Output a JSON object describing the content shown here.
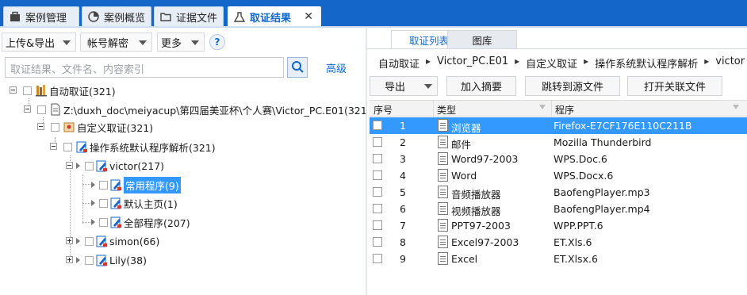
{
  "tabs": [
    {
      "label": "案例管理",
      "icon": "briefcase-icon"
    },
    {
      "label": "案例概览",
      "icon": "pie-chart-icon"
    },
    {
      "label": "证据文件",
      "icon": "folder-icon"
    },
    {
      "label": "取证结果",
      "icon": "flask-icon",
      "active": true
    }
  ],
  "toolbar": {
    "upload_export": "上传&导出",
    "account_decrypt": "帐号解密",
    "more": "更多",
    "help": "?"
  },
  "search": {
    "placeholder": "取证结果、文件名、内容索引",
    "advanced": "高级"
  },
  "tree": [
    {
      "label": "自动取证(321)"
    },
    {
      "label": "Z:\\duxh_doc\\meiyacup\\第四届美亚杯\\个人赛\\Victor_PC.E01(321)"
    },
    {
      "label": "自定义取证(321)"
    },
    {
      "label": "操作系统默认程序解析(321)"
    },
    {
      "label": "victor(217)"
    },
    {
      "label": "常用程序(9)",
      "selected": true
    },
    {
      "label": "默认主页(1)"
    },
    {
      "label": "全部程序(207)"
    },
    {
      "label": "simon(66)"
    },
    {
      "label": "Lily(38)"
    }
  ],
  "right": {
    "subtabs": [
      "取证列表",
      "图库"
    ],
    "breadcrumb": [
      "自动取证",
      "Victor_PC.E01",
      "自定义取证",
      "操作系统默认程序解析",
      "victor"
    ],
    "buttons": {
      "export": "导出",
      "add_summary": "加入摘要",
      "jump_source": "跳转到源文件",
      "open_related": "打开关联文件"
    },
    "columns": [
      "序号",
      "类型",
      "程序"
    ],
    "rows": [
      {
        "num": "1",
        "type": "浏览器",
        "program": "Firefox-E7CF176E110C211B",
        "selected": true
      },
      {
        "num": "2",
        "type": "邮件",
        "program": "Mozilla Thunderbird"
      },
      {
        "num": "3",
        "type": "Word97-2003",
        "program": "WPS.Doc.6"
      },
      {
        "num": "4",
        "type": "Word",
        "program": "WPS.Docx.6"
      },
      {
        "num": "5",
        "type": "音频播放器",
        "program": "BaofengPlayer.mp3"
      },
      {
        "num": "6",
        "type": "视频播放器",
        "program": "BaofengPlayer.mp4"
      },
      {
        "num": "7",
        "type": "PPT97-2003",
        "program": "WPP.PPT.6"
      },
      {
        "num": "8",
        "type": "Excel97-2003",
        "program": "ET.Xls.6"
      },
      {
        "num": "9",
        "type": "Excel",
        "program": "ET.Xlsx.6"
      }
    ]
  },
  "colors": {
    "brand_blue": "#1467c8",
    "selection": "#3399ff"
  }
}
